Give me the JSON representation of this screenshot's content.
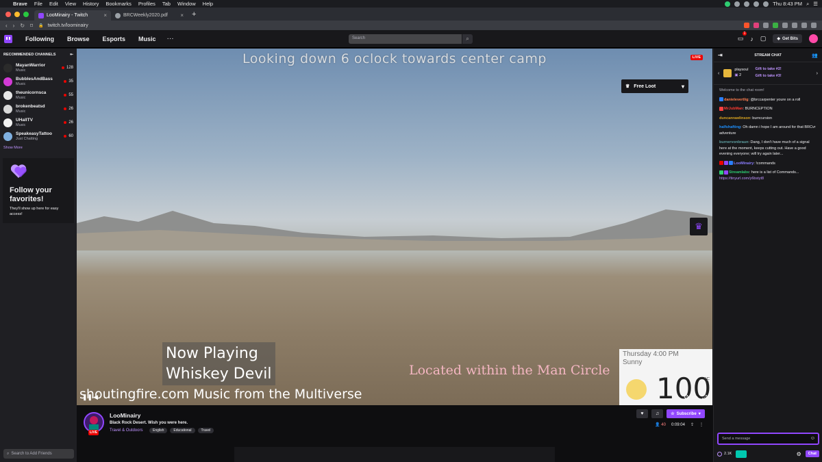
{
  "menubar": {
    "app": "Brave",
    "items": [
      "File",
      "Edit",
      "View",
      "History",
      "Bookmarks",
      "Profiles",
      "Tab",
      "Window",
      "Help"
    ],
    "clock": "Thu 8:43 PM"
  },
  "tabs": [
    {
      "label": "LooMinairy - Twitch",
      "active": true
    },
    {
      "label": "BRCWeekly2020.pdf",
      "active": false
    }
  ],
  "address": {
    "url": "twitch.tv/loominairy"
  },
  "twitch_nav": {
    "links": [
      "Following",
      "Browse",
      "Esports",
      "Music"
    ],
    "search_placeholder": "Search",
    "notif_count": "1",
    "get_bits": "Get Bits"
  },
  "sidebar": {
    "heading": "RECOMMENDED CHANNELS",
    "channels": [
      {
        "name": "MayanWarrior",
        "game": "Music",
        "viewers": "128",
        "color": "#2b2b2b"
      },
      {
        "name": "BubblesAndBass",
        "game": "Music",
        "viewers": "35",
        "color": "#d33ad6"
      },
      {
        "name": "theunicornsca",
        "game": "Music",
        "viewers": "55",
        "color": "#e8e8e8"
      },
      {
        "name": "brokenbeatsd",
        "game": "Music",
        "viewers": "26",
        "color": "#d8d8d8"
      },
      {
        "name": "UHallTV",
        "game": "Music",
        "viewers": "26",
        "color": "#f2f2f2"
      },
      {
        "name": "SpeakeasyTattoo",
        "game": "Just Chatting",
        "viewers": "60",
        "color": "#7fb0e0"
      }
    ],
    "show_more": "Show More",
    "follow_title": "Follow your favorites!",
    "follow_sub": "They'll show up here for easy access!",
    "add_friends": "Search to Add Friends"
  },
  "video": {
    "overlay_title": "Looking down 6 oclock towards center camp",
    "live": "LIVE",
    "free_loot": "Free Loot",
    "now_playing_1": "Now Playing",
    "now_playing_2": "Whiskey Devil",
    "ticker": "shoutingfire.com Music from the Multiverse",
    "location": "Located within the Man Circle",
    "weather_day": "Thursday 4:00 PM",
    "weather_cond": "Sunny",
    "weather_temp": "100",
    "weather_unit": "°F"
  },
  "stream_info": {
    "name": "LooMinairy",
    "title": "Black Rock Desert. Wish you were here.",
    "category": "Travel & Outdoors",
    "tags": [
      "English",
      "Educational",
      "Travel"
    ],
    "subscribe": "Subscribe",
    "viewers": "40",
    "uptime": "0:09:04",
    "live": "LIVE"
  },
  "chat": {
    "header": "STREAM CHAT",
    "gift_user": "playsoul",
    "gift_count": "2",
    "gift_take_1": "Gift to take #2!",
    "gift_take_2": "Gift to take #3!",
    "welcome": "Welcome to the chat room!",
    "messages": [
      {
        "user": "danielevertlig",
        "color": "#ff7f50",
        "text": "@brccarpenter youre on a roll"
      },
      {
        "user": "MrJubMan",
        "color": "#ff3b30",
        "text": "BURNCEPTION"
      },
      {
        "user": "duncanrawlinson",
        "color": "#daa520",
        "text": "burncursion"
      },
      {
        "user": "halfshafting",
        "color": "#1e90ff",
        "text": "Oh damn i hope I am around for that BRCvr adventure"
      },
      {
        "user": "burnervonbraun",
        "color": "#5f9ea0",
        "text": "Dang, I don't have much of a signal here at the moment, keeps cutting out. Have a good evening everyone; will try again later..."
      },
      {
        "user": "LooMinairy",
        "color": "#8a7cff",
        "text": "!commands"
      },
      {
        "user": "Streamlabs",
        "color": "#2ecc71",
        "text": "here is a list of Commands...",
        "link": "https://tinyurl.com/y6bstyt8"
      }
    ],
    "input_placeholder": "Send a message",
    "points": "2.1K",
    "chat_button": "Chat"
  }
}
